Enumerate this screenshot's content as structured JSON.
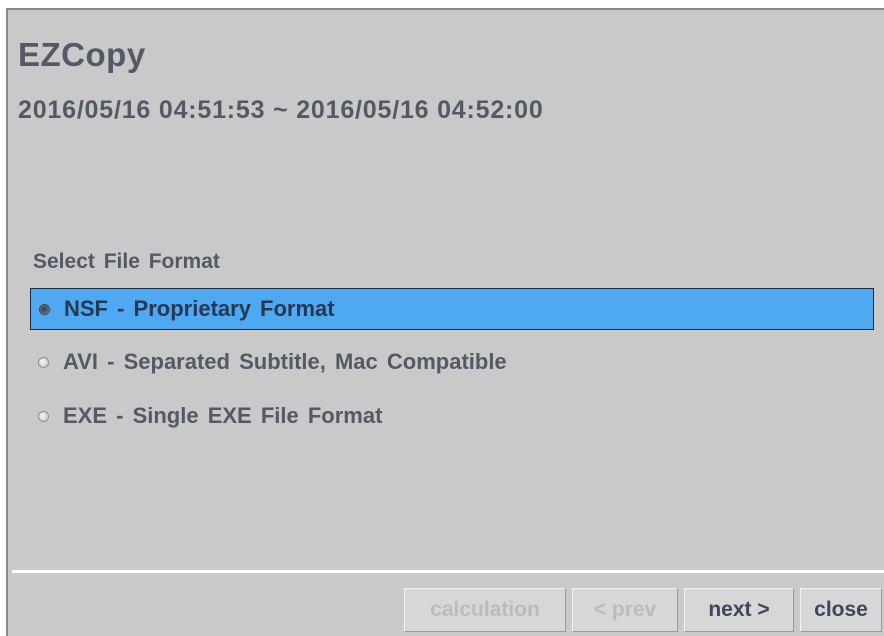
{
  "window": {
    "title": "EZCopy",
    "time_range": "2016/05/16 04:51:53 ~ 2016/05/16 04:52:00"
  },
  "format_section": {
    "label": "Select File Format",
    "options": [
      {
        "label": "NSF - Proprietary Format",
        "selected": true
      },
      {
        "label": "AVI - Separated Subtitle, Mac Compatible",
        "selected": false
      },
      {
        "label": "EXE - Single EXE File Format",
        "selected": false
      }
    ]
  },
  "buttons": {
    "calculation": {
      "label": "calculation",
      "enabled": false
    },
    "prev": {
      "label": "< prev",
      "enabled": false
    },
    "next": {
      "label": "next >",
      "enabled": true
    },
    "close": {
      "label": "close",
      "enabled": true
    }
  },
  "colors": {
    "background": "#c9c9c9",
    "selection": "#4fa8f2",
    "text": "#535a66"
  }
}
